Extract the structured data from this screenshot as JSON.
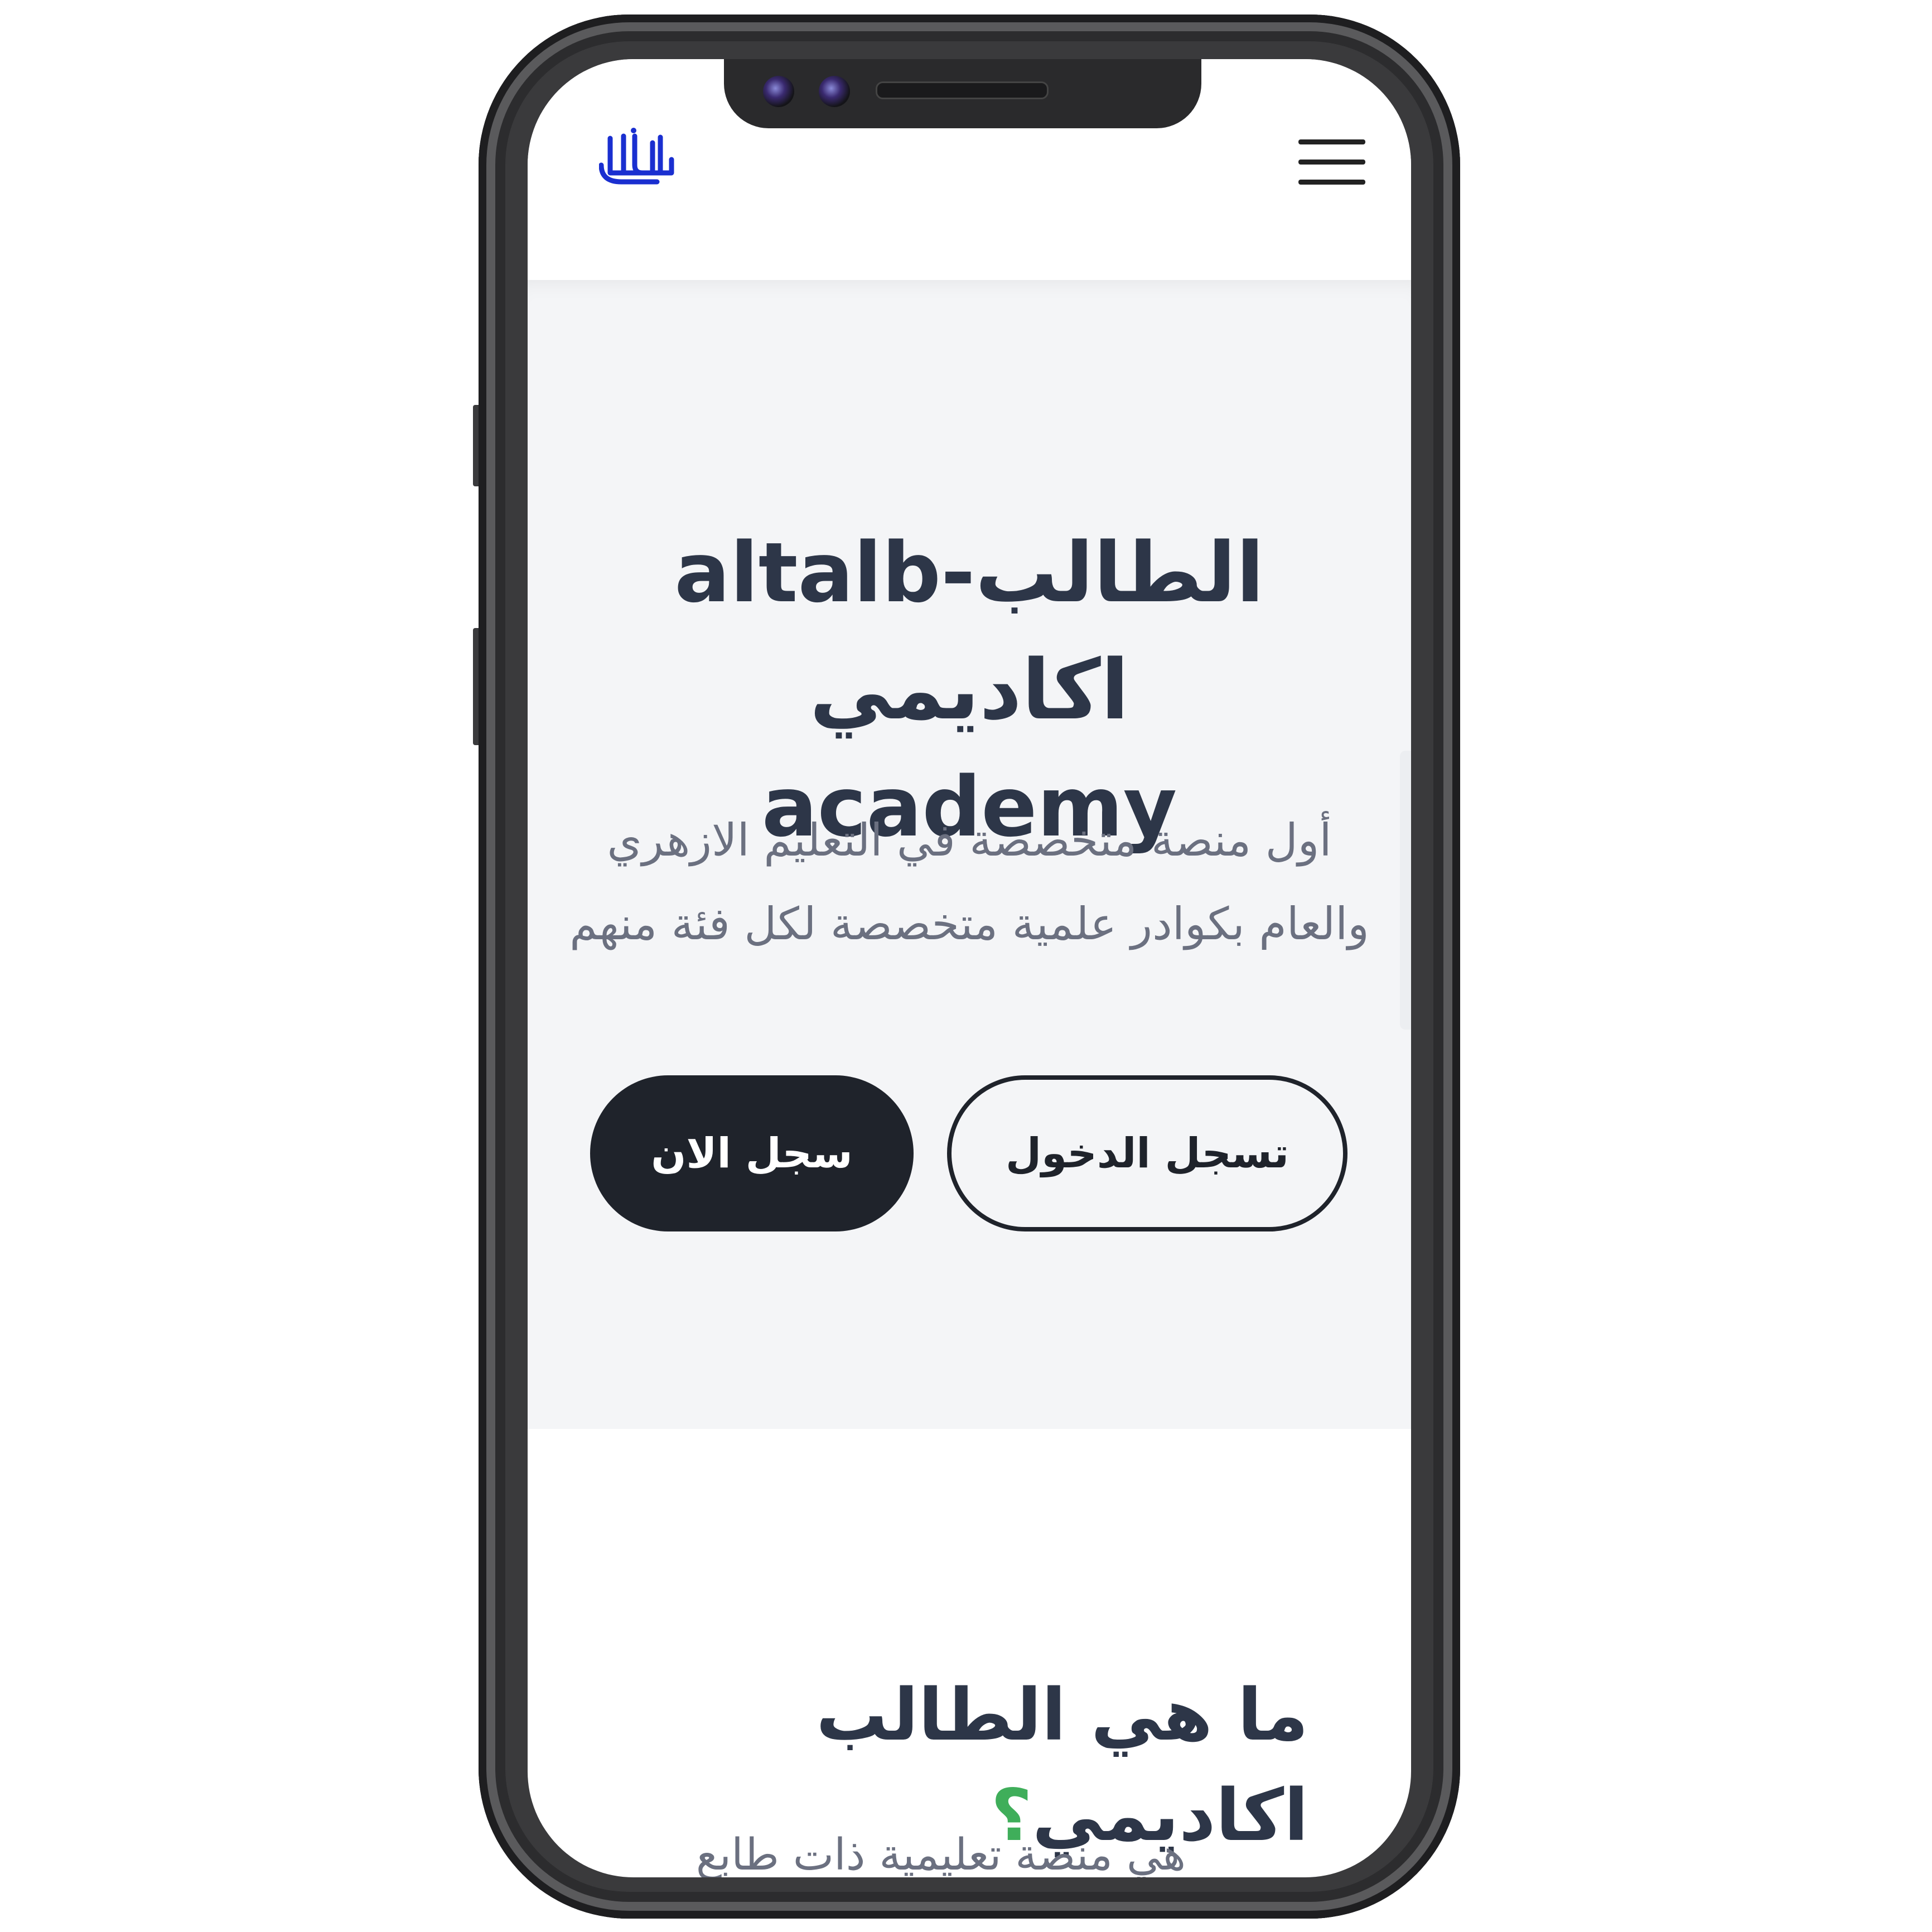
{
  "header": {
    "logo_text": "الطالب",
    "menu_label": "القائمة"
  },
  "hero": {
    "title_line1": "altalb-الطالب اكاديمي",
    "title_line2": "academy",
    "description": "أول منصة متخصصة في التعليم الازهري والعام بكوادر علمية متخصصة لكل فئة منهم",
    "login_button": "تسجل الدخول",
    "register_button": "سجل الان"
  },
  "about": {
    "title": "ما هي الطالب اكاديمي",
    "question_mark": "؟",
    "text": "هي منصة تعليمية ذات طابع مختلف"
  },
  "colors": {
    "heading": "#2d3648",
    "body_text": "#6b7080",
    "button_dark": "#1f232b",
    "accent_green": "#3fae5a",
    "logo_blue": "#1a2fd0",
    "hero_bg": "#f4f5f7"
  }
}
